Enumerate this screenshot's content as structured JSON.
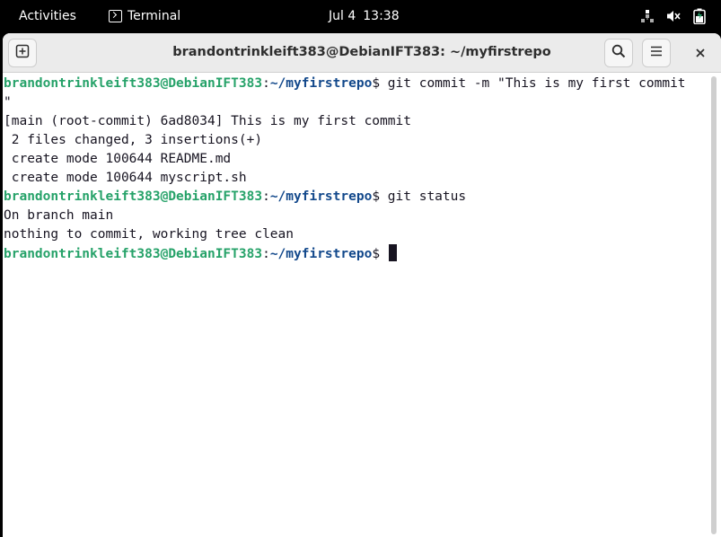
{
  "topbar": {
    "activities": "Activities",
    "app_name": "Terminal",
    "date": "Jul 4",
    "time": "13:38"
  },
  "window": {
    "title": "brandontrinkleift383@DebianIFT383: ~/myfirstrepo"
  },
  "terminal": {
    "prompt_user": "brandontrinkleift383@DebianIFT383",
    "prompt_path": "~/myfirstrepo",
    "prompt_suffix": "$",
    "cmd1_line1": " git commit -m \"This is my first commit",
    "cmd1_line2": "\"",
    "out1": "[main (root-commit) 6ad8034] This is my first commit",
    "out2": " 2 files changed, 3 insertions(+)",
    "out3": " create mode 100644 README.md",
    "out4": " create mode 100644 myscript.sh",
    "cmd2": " git status",
    "out5": "On branch main",
    "out6": "nothing to commit, working tree clean",
    "cmd3": " "
  },
  "colors": {
    "prompt_user": "#26a269",
    "prompt_path": "#12488b",
    "text": "#171421"
  },
  "icons": {
    "new_tab": "new-tab-icon",
    "search": "search-icon",
    "menu": "hamburger-menu-icon",
    "close": "close-icon",
    "network": "network-icon",
    "volume": "volume-muted-icon",
    "battery": "battery-icon"
  }
}
